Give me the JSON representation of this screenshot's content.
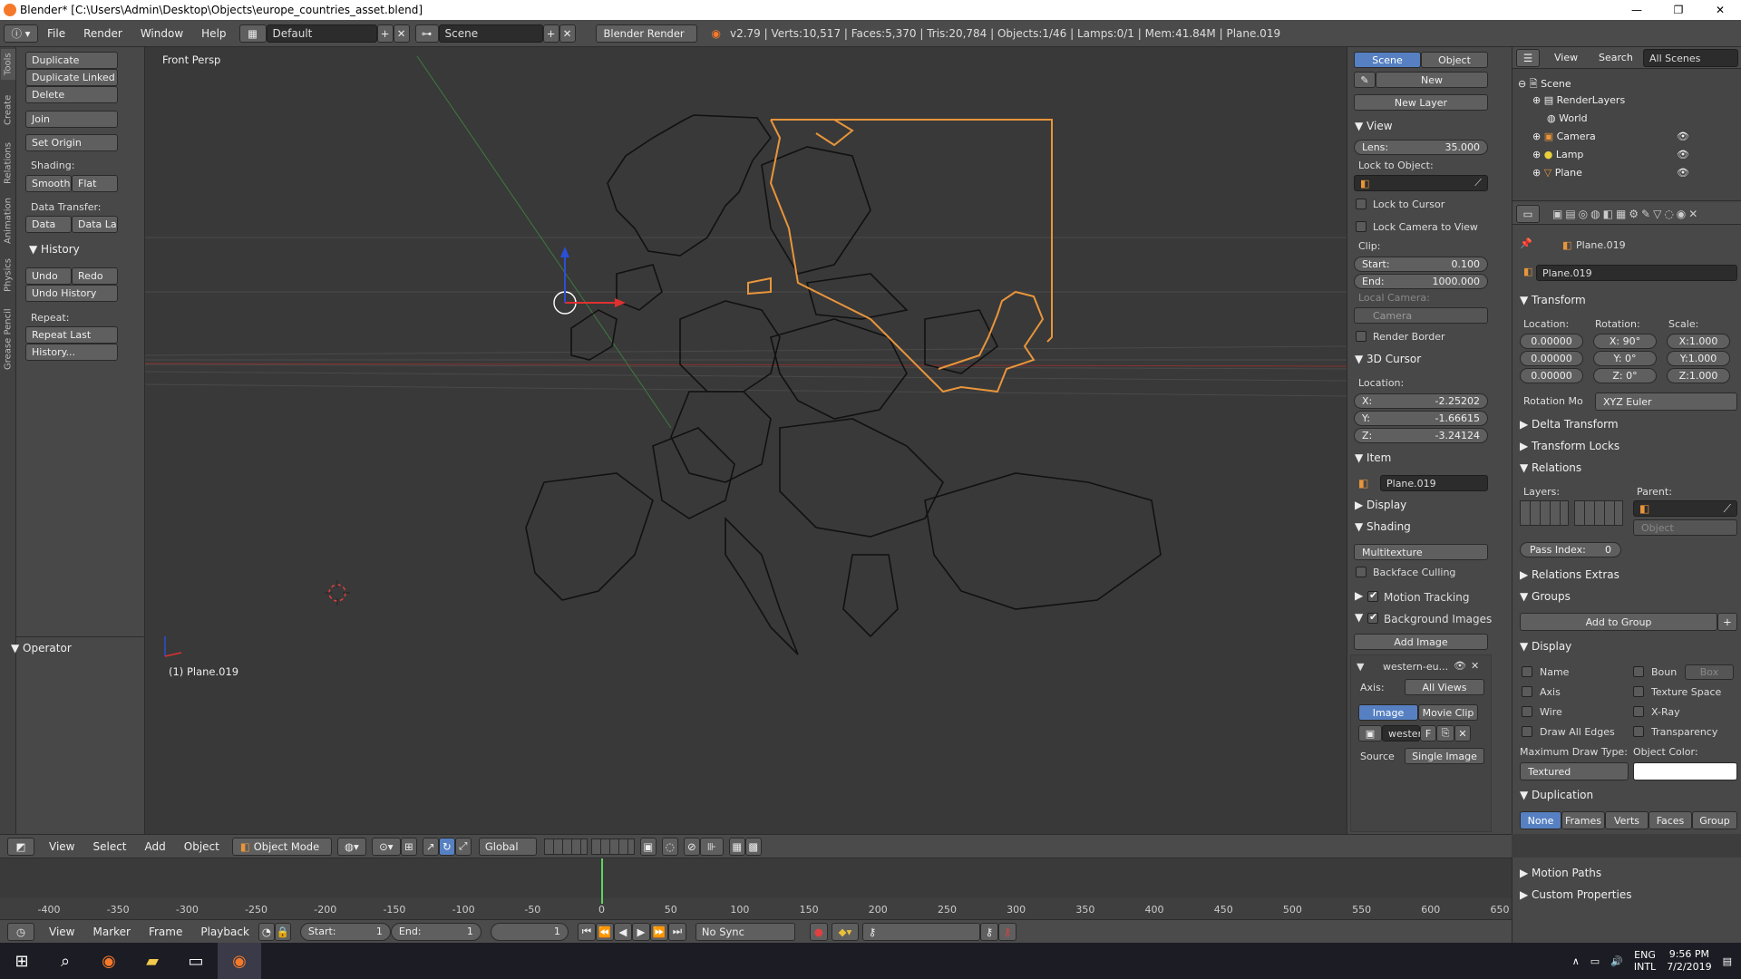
{
  "window": {
    "title": "Blender* [C:\\Users\\Admin\\Desktop\\Objects\\europe_countries_asset.blend]",
    "min": "—",
    "max": "❐",
    "close": "✕"
  },
  "menu": [
    "File",
    "Render",
    "Window",
    "Help"
  ],
  "top": {
    "layout": "Default",
    "scene": "Scene",
    "engine": "Blender Render",
    "stats": "v2.79 | Verts:10,517 | Faces:5,370 | Tris:20,784 | Objects:1/46 | Lamps:0/1 | Mem:41.84M | Plane.019"
  },
  "tabs": [
    "Tools",
    "Create",
    "Relations",
    "Animation",
    "Physics",
    "Grease Pencil"
  ],
  "toolshelf": {
    "duplicate": "Duplicate",
    "duplicate_linked": "Duplicate Linked",
    "delete": "Delete",
    "join": "Join",
    "set_origin": "Set Origin",
    "shading_label": "Shading:",
    "smooth": "Smooth",
    "flat": "Flat",
    "data_transfer_label": "Data Transfer:",
    "data": "Data",
    "data_la": "Data La",
    "history_header": "History",
    "undo": "Undo",
    "redo": "Redo",
    "undo_history": "Undo History",
    "repeat_label": "Repeat:",
    "repeat_last": "Repeat Last",
    "history_dots": "History...",
    "operator_header": "Operator"
  },
  "viewport": {
    "view_name": "Front Persp",
    "object_label": "(1) Plane.019"
  },
  "npanel": {
    "tab_scene": "Scene",
    "tab_object": "Object",
    "new": "New",
    "new_layer": "New Layer",
    "view_header": "View",
    "lens_label": "Lens:",
    "lens_value": "35.000",
    "lock_to_object": "Lock to Object:",
    "lock_to_cursor": "Lock to Cursor",
    "lock_camera": "Lock Camera to View",
    "clip_label": "Clip:",
    "start_label": "Start:",
    "start_value": "0.100",
    "end_label": "End:",
    "end_value": "1000.000",
    "local_camera": "Local Camera:",
    "camera": "Camera",
    "render_border": "Render Border",
    "cursor_header": "3D Cursor",
    "location_label": "Location:",
    "x_label": "X:",
    "x_value": "-2.25202",
    "y_label": "Y:",
    "y_value": "-1.66615",
    "z_label": "Z:",
    "z_value": "-3.24124",
    "item_header": "Item",
    "item_name": "Plane.019",
    "display_header": "Display",
    "shading_header": "Shading",
    "shading_mode": "Multitexture",
    "backface": "Backface Culling",
    "motion_tracking": "Motion Tracking",
    "bg_images": "Background Images",
    "add_image": "Add Image",
    "image_name": "western-eu...",
    "axis_label": "Axis:",
    "axis_value": "All Views",
    "image_tab": "Image",
    "movie_clip_tab": "Movie Clip",
    "image_field": "wester",
    "image_f": "F",
    "source_label": "Source",
    "source_value": "Single Image"
  },
  "outliner": {
    "view": "View",
    "search": "Search",
    "all_scenes": "All Scenes",
    "items": [
      "Scene",
      "RenderLayers",
      "World",
      "Camera",
      "Lamp",
      "Plane"
    ]
  },
  "props": {
    "object_path": "Plane.019",
    "object_name": "Plane.019",
    "transform_header": "Transform",
    "location_label": "Location:",
    "rotation_label": "Rotation:",
    "scale_label": "Scale:",
    "loc": [
      "0.00000",
      "0.00000",
      "0.00000"
    ],
    "rot": [
      "X:  90°",
      "Y:    0°",
      "Z:    0°"
    ],
    "scale": [
      "X:1.000",
      "Y:1.000",
      "Z:1.000"
    ],
    "rotation_mode_label": "Rotation Mo",
    "rotation_mode": "XYZ Euler",
    "delta_transform": "Delta Transform",
    "transform_locks": "Transform Locks",
    "relations_header": "Relations",
    "layers_label": "Layers:",
    "parent_label": "Parent:",
    "parent_type": "Object",
    "pass_index": "Pass Index:",
    "pass_index_value": "0",
    "relations_extras": "Relations Extras",
    "groups_header": "Groups",
    "add_to_group": "Add to Group",
    "display_header": "Display",
    "name": "Name",
    "bounds": "Boun",
    "box": "Box",
    "axis": "Axis",
    "texture_space": "Texture Space",
    "wire": "Wire",
    "xray": "X-Ray",
    "draw_all_edges": "Draw All Edges",
    "transparency": "Transparency",
    "max_draw_type_label": "Maximum Draw Type:",
    "object_color_label": "Object Color:",
    "max_draw_type": "Textured",
    "duplication_header": "Duplication",
    "dup_none": "None",
    "dup_frames": "Frames",
    "dup_verts": "Verts",
    "dup_faces": "Faces",
    "dup_group": "Group",
    "motion_paths": "Motion Paths",
    "custom_properties": "Custom Properties"
  },
  "vphdr": {
    "view": "View",
    "select": "Select",
    "add": "Add",
    "object": "Object",
    "mode": "Object Mode",
    "orientation": "Global"
  },
  "timeline": {
    "ticks": [
      "-400",
      "-350",
      "-300",
      "-250",
      "-200",
      "-150",
      "-100",
      "-50",
      "0",
      "50",
      "100",
      "150",
      "200",
      "250",
      "300",
      "350",
      "400",
      "450",
      "500",
      "550",
      "600",
      "650"
    ]
  },
  "tlhdr": {
    "view": "View",
    "marker": "Marker",
    "frame": "Frame",
    "playback": "Playback",
    "start_label": "Start:",
    "start_value": "1",
    "end_label": "End:",
    "end_value": "1",
    "current": "1",
    "sync": "No Sync"
  },
  "taskbar": {
    "lang1": "ENG",
    "lang2": "INTL",
    "time": "9:56 PM",
    "date": "7/2/2019"
  }
}
